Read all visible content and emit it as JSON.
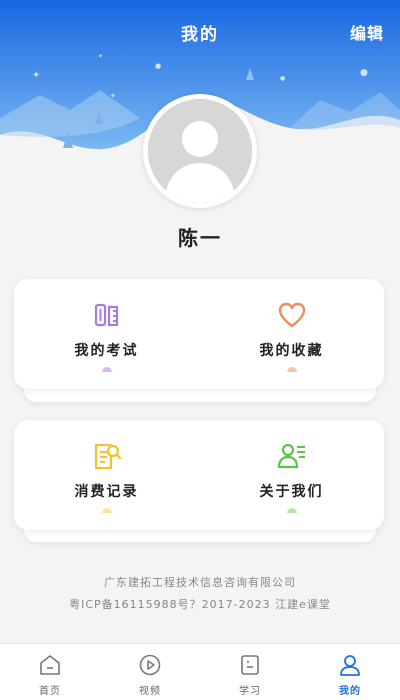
{
  "header": {
    "title": "我的",
    "edit_label": "编辑"
  },
  "profile": {
    "name": "陈一"
  },
  "cards": [
    [
      {
        "label": "我的考试",
        "icon": "pencil-ruler-icon",
        "color": "#a77be0"
      },
      {
        "label": "我的收藏",
        "icon": "heart-icon",
        "color": "#f08a5a"
      }
    ],
    [
      {
        "label": "消费记录",
        "icon": "receipt-search-icon",
        "color": "#f2c230"
      },
      {
        "label": "关于我们",
        "icon": "user-list-icon",
        "color": "#5cc14a"
      }
    ]
  ],
  "footer": {
    "company": "广东建拓工程技术信息咨询有限公司",
    "icp": "粤ICP备16115988号？2017-2023 江建e课堂"
  },
  "tabs": [
    {
      "label": "首页",
      "icon": "home-icon",
      "active": false
    },
    {
      "label": "视频",
      "icon": "play-icon",
      "active": false
    },
    {
      "label": "学习",
      "icon": "study-icon",
      "active": false
    },
    {
      "label": "我的",
      "icon": "user-icon",
      "active": true
    }
  ],
  "colors": {
    "accent": "#1e73d8",
    "header_top": "#1a6fe6",
    "header_bottom": "#6fb2f0"
  }
}
